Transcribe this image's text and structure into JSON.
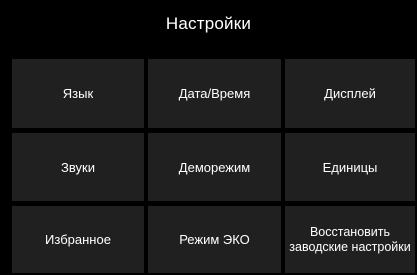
{
  "header": {
    "title": "Настройки"
  },
  "tiles": [
    {
      "label": "Язык"
    },
    {
      "label": "Дата/Время"
    },
    {
      "label": "Дисплей"
    },
    {
      "label": "Звуки"
    },
    {
      "label": "Деморежим"
    },
    {
      "label": "Единицы"
    },
    {
      "label": "Избранное"
    },
    {
      "label": "Режим  ЭКО"
    },
    {
      "label": "Восстановить\nзаводские настройки"
    }
  ],
  "colors": {
    "background": "#000000",
    "tile": "#202020",
    "text": "#ffffff"
  }
}
